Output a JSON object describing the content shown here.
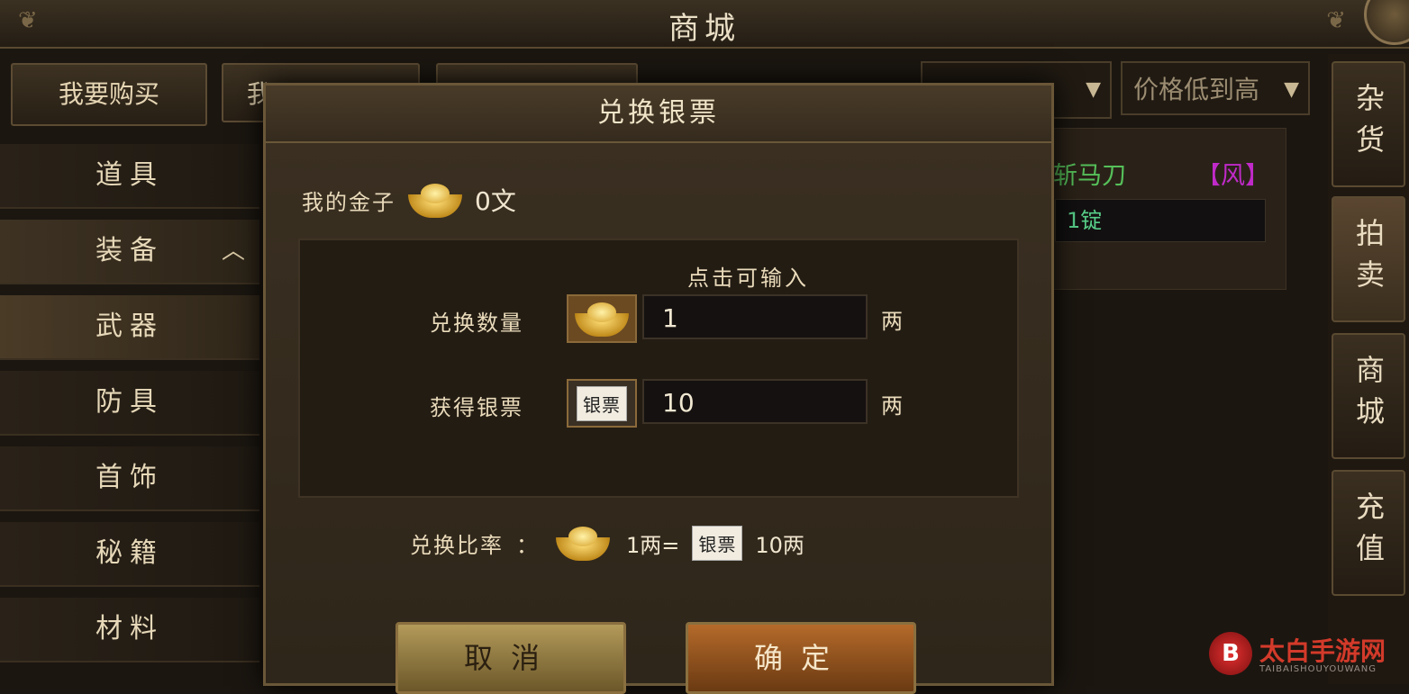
{
  "header": {
    "title": "商城"
  },
  "top_tabs": [
    {
      "label": "我要购买"
    },
    {
      "label": "我"
    },
    {
      "label": ""
    }
  ],
  "sort": {
    "left_label": "",
    "right_label": "价格低到高"
  },
  "left_menu": [
    {
      "label": "道具"
    },
    {
      "label": "装备",
      "expanded": true
    },
    {
      "label": "武器",
      "selected": true
    },
    {
      "label": "防具"
    },
    {
      "label": "首饰"
    },
    {
      "label": "秘籍"
    },
    {
      "label": "材料"
    }
  ],
  "right_tabs": [
    {
      "label": "杂货"
    },
    {
      "label": "拍卖"
    },
    {
      "label": "商城"
    },
    {
      "label": "充值"
    }
  ],
  "item_card": {
    "name": "斩马刀",
    "tag": "【风】",
    "price": "1锭"
  },
  "dialog": {
    "title": "兑换银票",
    "my_gold_label": "我的金子",
    "my_gold_value": "0文",
    "hint": "点击可输入",
    "exchange_amount_label": "兑换数量",
    "exchange_amount_value": "1",
    "obtain_label": "获得银票",
    "obtain_value": "10",
    "unit": "两",
    "ratio_label": "兑换比率",
    "ratio_colon": "：",
    "ratio_left": "1两=",
    "ratio_right": "10两",
    "note_text": "银票",
    "cancel_label": "取消",
    "ok_label": "确定"
  },
  "watermark": {
    "text": "太白手游网",
    "sub": "TAIBAISHOUYOUWANG"
  },
  "colors": {
    "accent": "#6a5738",
    "green": "#56c05a",
    "purple": "#c02ac9"
  }
}
